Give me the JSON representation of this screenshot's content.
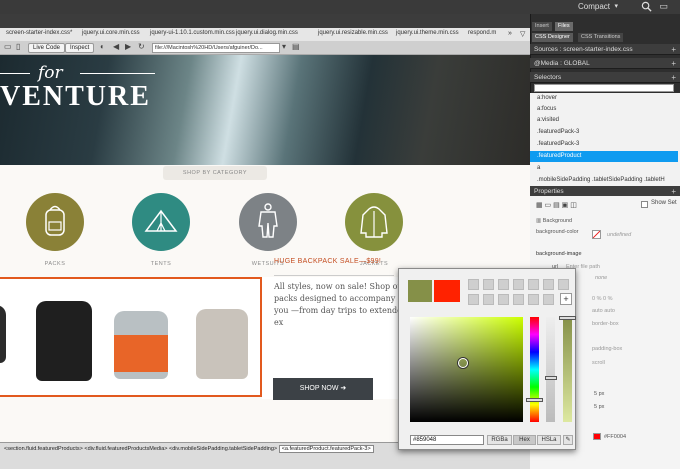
{
  "app": {
    "workspace": "Compact"
  },
  "file_tabs": [
    "screen-starter-index.css*",
    "jquery.ui.core.min.css",
    "jquery-ui-1.10.1.custom.min.css",
    "jquery.ui.dialog.min.css",
    "jquery.ui.resizable.min.css",
    "jquery.ui.theme.min.css",
    "respond.m"
  ],
  "toolbar": {
    "live_code": "Live Code",
    "inspect": "Inspect",
    "url": "file:///Macintosh%20HD/Users/afguiner/Do..."
  },
  "page": {
    "hero_for": "for",
    "hero_title": "VENTURE",
    "shop_by_category": "SHOP BY CATEGORY",
    "categories": [
      {
        "label": "PACKS",
        "color": "#8a8137",
        "icon": "backpack-icon"
      },
      {
        "label": "TENTS",
        "color": "#2f8b82",
        "icon": "tent-icon"
      },
      {
        "label": "WETSUITS",
        "color": "#7d8286",
        "icon": "wetsuit-icon"
      },
      {
        "label": "JACKETS",
        "color": "#86913d",
        "icon": "jacket-icon"
      }
    ],
    "sale_title": "HUGE BACKPACK SALE—$99!",
    "sale_body": "All styles, now on sale! Shop our packs designed to accompany you —from day trips to extended ex",
    "shop_now": "SHOP NOW ➜"
  },
  "status": {
    "crumbs_before": "<section.fluid.featuredProducts>  <div.fluid.featuredProductsMedia>  <div.mobileSidePadding.tabletSidePadding>",
    "crumb_selected": "<a.featuredProduct.featuredPack-3>"
  },
  "panel": {
    "tab_insert": "Insert",
    "tab_files": "Files",
    "tab_css_designer": "CSS Designer",
    "tab_css_transitions": "CSS Transitions",
    "sources": "Sources : screen-starter-index.css",
    "media": "@Media : GLOBAL",
    "selectors_head": "Selectors",
    "selectors": [
      "a:hover",
      "a:focus",
      "a:visited",
      ".featuredPack-3",
      ".featuredPack-3",
      ".featuredProduct",
      "a",
      ".mobileSidePadding .tabletSidePadding .tabletH"
    ],
    "active_selector_index": 5,
    "properties_head": "Properties",
    "show_set": "Show Set",
    "background": "Background",
    "background_color": "background-color",
    "undefined": "undefined",
    "background_image": "background-image",
    "url_label": "url",
    "url_placeholder": "Enter file path",
    "none": "none",
    "gradient_label": "gradient",
    "bg_pos": "0 %   0 %",
    "bg_size": "auto   auto",
    "border_box": "border-box",
    "padding_box": "padding-box",
    "scroll": "scroll",
    "px1": "5 px",
    "px2": "5 px",
    "hex_value": "#FF0004"
  },
  "picker": {
    "old_color": "#859048",
    "new_color": "#FF2200",
    "hex": "#859048",
    "modes": [
      "RGBa",
      "Hex",
      "HSLa"
    ],
    "active_mode": "Hex"
  }
}
